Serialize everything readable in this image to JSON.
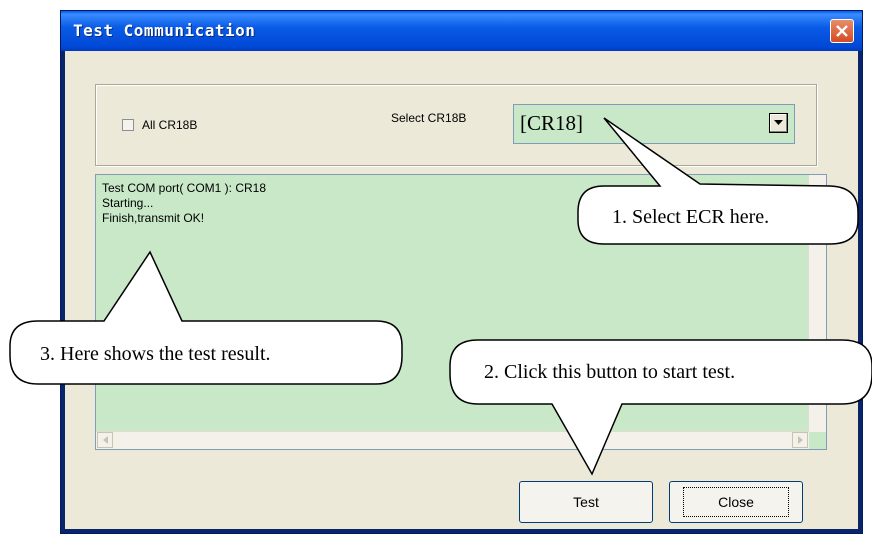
{
  "window": {
    "title": "Test Communication"
  },
  "options": {
    "all_checkbox_label": "All CR18B",
    "all_checkbox_checked": false,
    "select_label": "Select CR18B",
    "selected_value": "[CR18]"
  },
  "log": {
    "lines": [
      "Test COM port( COM1 ): CR18",
      "Starting...",
      "Finish,transmit OK!"
    ]
  },
  "buttons": {
    "test": "Test",
    "close": "Close"
  },
  "callouts": {
    "select": "1. Select ECR here.",
    "test": "2. Click this button to start test.",
    "result": "3. Here shows the test result."
  },
  "colors": {
    "field_bg": "#c8e8c8",
    "titlebar": "#0a5ce6",
    "close_button": "#d44a22"
  }
}
